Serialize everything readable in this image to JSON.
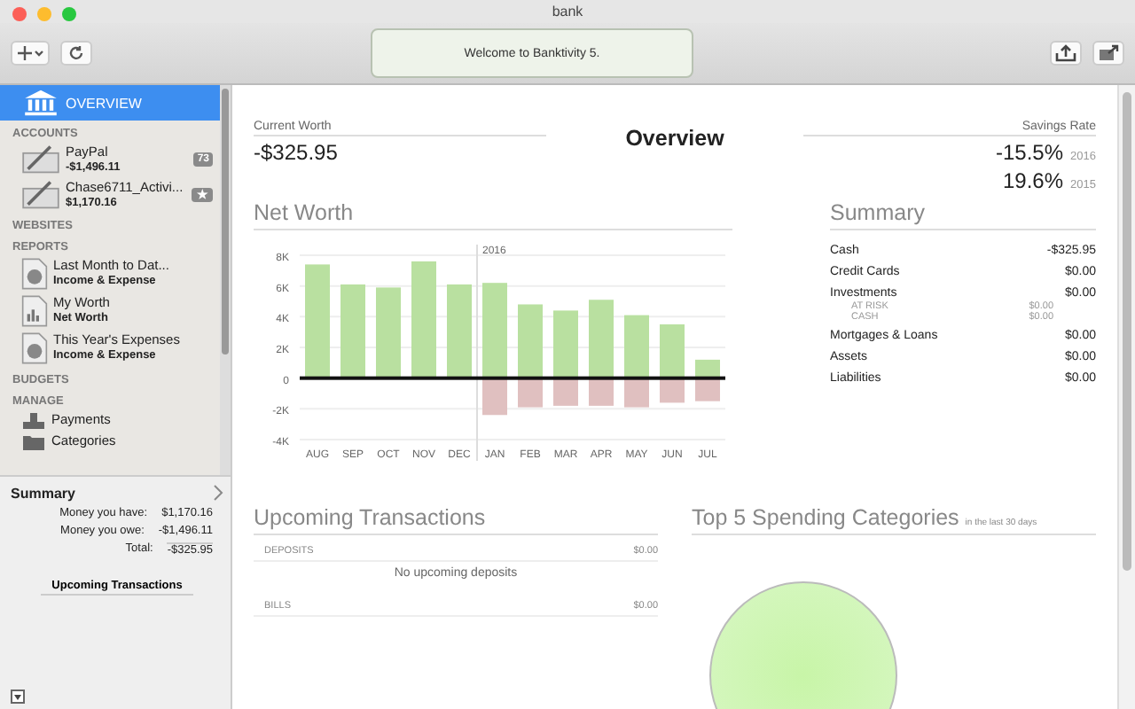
{
  "window": {
    "title": "bank",
    "status": "Welcome to Banktivity 5."
  },
  "sidebar": {
    "overview": {
      "label": "OVERVIEW",
      "selected": true
    },
    "sections": [
      {
        "title": "ACCOUNTS",
        "kind": "accounts",
        "items": [
          {
            "name": "PayPal",
            "amount": "-$1,496.11",
            "badge": "73",
            "kind": "count"
          },
          {
            "name": "Chase6711_Activi...",
            "amount": "$1,170.16",
            "badge": "★",
            "kind": "star"
          }
        ]
      },
      {
        "title": "WEBSITES",
        "kind": "plain"
      },
      {
        "title": "REPORTS",
        "kind": "reports",
        "items": [
          {
            "name": "Last Month to Dat...",
            "sub": "Income & Expense"
          },
          {
            "name": "My Worth",
            "sub": "Net Worth"
          },
          {
            "name": "This Year's Expenses",
            "sub": "Income & Expense"
          }
        ]
      },
      {
        "title": "BUDGETS",
        "kind": "plain"
      },
      {
        "title": "MANAGE",
        "kind": "manage",
        "items": [
          {
            "name": "Payments"
          },
          {
            "name": "Categories"
          }
        ]
      }
    ]
  },
  "summary_panel": {
    "title": "Summary",
    "rows": [
      {
        "label": "Money you have:",
        "value": "$1,170.16"
      },
      {
        "label": "Money you owe:",
        "value": "-$1,496.11"
      },
      {
        "label": "Total:",
        "value": "-$325.95"
      }
    ],
    "button": "Upcoming Transactions"
  },
  "overview": {
    "title": "Overview",
    "current_worth": {
      "label": "Current Worth",
      "value": "-$325.95"
    },
    "savings_rate": {
      "label": "Savings Rate",
      "rows": [
        {
          "value": "-15.5%",
          "year": "2016"
        },
        {
          "value": "19.6%",
          "year": "2015"
        }
      ]
    }
  },
  "net_worth": {
    "title": "Net Worth",
    "chart_data": {
      "type": "bar",
      "stacked": true,
      "categories": [
        "AUG",
        "SEP",
        "OCT",
        "NOV",
        "DEC",
        "JAN",
        "FEB",
        "MAR",
        "APR",
        "MAY",
        "JUN",
        "JUL"
      ],
      "grid": true,
      "series": [
        {
          "color": "#b9e0a0",
          "values": [
            7400,
            6100,
            5900,
            7600,
            6100,
            6200,
            4800,
            4400,
            5100,
            4100,
            3500,
            1200
          ]
        },
        {
          "color": "#e0c0c0",
          "values": [
            null,
            null,
            null,
            null,
            null,
            -2400,
            -1900,
            -1800,
            -1800,
            -1900,
            -1600,
            -1500
          ]
        }
      ],
      "ylim": [
        -4000,
        8000
      ],
      "yticks": [
        {
          "value": 8000,
          "label": "8K"
        },
        {
          "value": 6000,
          "label": "6K"
        },
        {
          "value": 4000,
          "label": "4K"
        },
        {
          "value": 2000,
          "label": "2K"
        },
        {
          "value": 0,
          "label": "0"
        },
        {
          "value": -2000,
          "label": "-2K"
        },
        {
          "value": -4000,
          "label": "-4K"
        }
      ],
      "ref_lines": [
        {
          "axis": "x",
          "value": "JAN",
          "label": "2016"
        }
      ]
    }
  },
  "summary": {
    "title": "Summary",
    "rows": [
      {
        "label": "Cash",
        "value": "-$325.95",
        "kind": "main"
      },
      {
        "label": "Credit Cards",
        "value": "$0.00",
        "kind": "main"
      },
      {
        "label": "Investments",
        "value": "$0.00",
        "kind": "main"
      },
      {
        "label": "AT RISK",
        "value": "$0.00",
        "kind": "sub"
      },
      {
        "label": "CASH",
        "value": "$0.00",
        "kind": "sub"
      },
      {
        "label": "Mortgages & Loans",
        "value": "$0.00",
        "kind": "main"
      },
      {
        "label": "Assets",
        "value": "$0.00",
        "kind": "main"
      },
      {
        "label": "Liabilities",
        "value": "$0.00",
        "kind": "main"
      }
    ]
  },
  "upcoming": {
    "title": "Upcoming Transactions",
    "groups": [
      {
        "label": "DEPOSITS",
        "value": "$0.00",
        "empty": "No upcoming deposits"
      },
      {
        "label": "BILLS",
        "value": "$0.00"
      }
    ]
  },
  "top_spending": {
    "title": "Top 5 Spending Categories",
    "note": "in the last 30 days"
  }
}
